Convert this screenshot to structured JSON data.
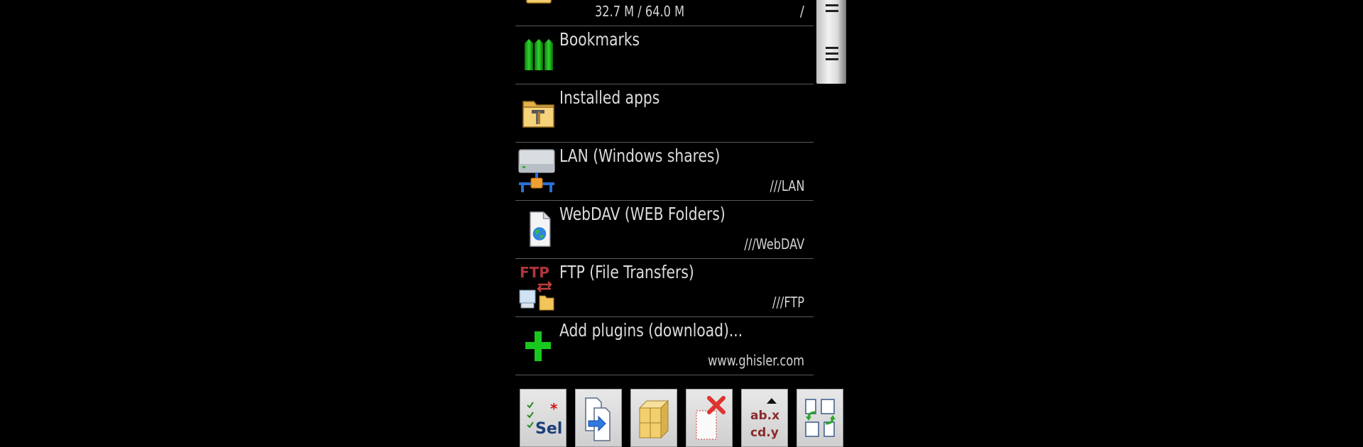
{
  "list": {
    "items": [
      {
        "name": "",
        "left_detail": "32.7 M / 64.0 M",
        "right_detail": "/",
        "icon": "folder-icon"
      },
      {
        "name": "Bookmarks",
        "detail": "",
        "icon": "bookmarks-icon"
      },
      {
        "name": "Installed apps",
        "detail": "",
        "icon": "apps-folder-icon"
      },
      {
        "name": "LAN (Windows shares)",
        "detail": "///LAN",
        "icon": "network-icon"
      },
      {
        "name": "WebDAV (WEB Folders)",
        "detail": "///WebDAV",
        "icon": "webdav-icon"
      },
      {
        "name": "FTP (File Transfers)",
        "detail": "///FTP",
        "icon": "ftp-icon"
      },
      {
        "name": "Add plugins (download)...",
        "detail": "www.ghisler.com",
        "icon": "add-plugin-icon"
      }
    ]
  },
  "toolbar": {
    "buttons": [
      {
        "id": "select",
        "icon": "select-icon"
      },
      {
        "id": "copy",
        "icon": "copy-icon"
      },
      {
        "id": "pack",
        "icon": "archive-icon"
      },
      {
        "id": "delete",
        "icon": "delete-icon"
      },
      {
        "id": "rename",
        "icon": "rename-icon"
      },
      {
        "id": "swap",
        "icon": "swap-panels-icon"
      }
    ],
    "select_text": "Sel",
    "rename_text_1": "ab.x",
    "rename_text_2": "cd.y"
  },
  "colors": {
    "background": "#000000",
    "text": "#d6d6d6",
    "divider": "#5a5a5a",
    "accent_green": "#19c81e",
    "ftp_red": "#b0343c"
  }
}
